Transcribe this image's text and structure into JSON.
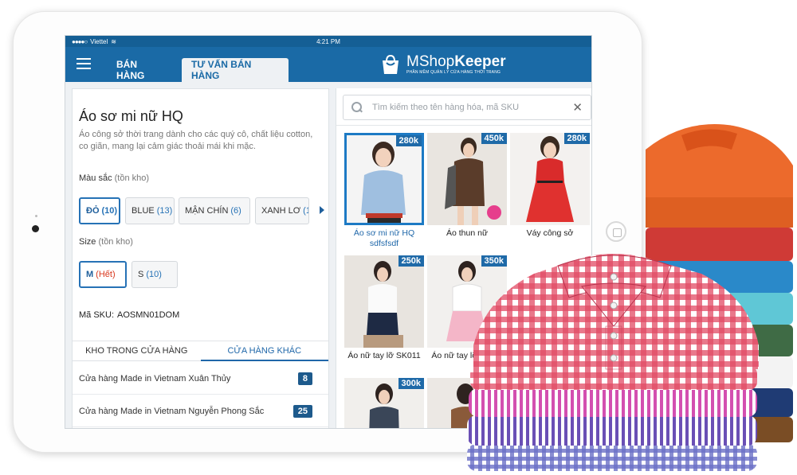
{
  "status_bar": {
    "carrier": "Viettel",
    "time": "4:21 PM"
  },
  "header": {
    "menu_icon": "hamburger-icon",
    "tabs": [
      {
        "label": "BÁN HÀNG",
        "active": false
      },
      {
        "label": "TƯ VẤN BÁN HÀNG",
        "active": true
      }
    ],
    "logo": {
      "name_light": "MShop",
      "name_bold": "Keeper",
      "tagline": "PHẦN MỀM QUẢN LÝ CỬA HÀNG THỜI TRANG"
    }
  },
  "product": {
    "title": "Áo sơ mi nữ HQ",
    "description": "Áo công sở thời trang dành cho các quý cô, chất liệu cotton, co giãn, mang lại cảm giác thoải mái khi mặc.",
    "color_label": "Màu sắc",
    "color_note": "(tồn kho)",
    "colors": [
      {
        "name": "ĐỎ",
        "count": "(10)",
        "selected": true
      },
      {
        "name": "BLUE",
        "count": "(13)",
        "selected": false
      },
      {
        "name": "MẬN CHÍN",
        "count": "(6)",
        "selected": false
      },
      {
        "name": "XANH LƠ",
        "count": "(1",
        "selected": false
      }
    ],
    "size_label": "Size",
    "size_note": "(tồn kho)",
    "sizes": [
      {
        "name": "M",
        "count": "(Hết)",
        "selected": true
      },
      {
        "name": "S",
        "count": "(10)",
        "selected": false
      }
    ],
    "sku_label": "Mã SKU:",
    "sku_value": "AOSMN01DOM"
  },
  "stock_tabs": [
    {
      "label": "KHO TRONG CỬA HÀNG",
      "active": false
    },
    {
      "label": "CỬA HÀNG KHÁC",
      "active": true
    }
  ],
  "stores": [
    {
      "name": "Cửa hàng Made in Vietnam Xuân Thủy",
      "qty": "8"
    },
    {
      "name": "Cửa hàng Made in Vietnam Nguyễn Phong Sắc",
      "qty": "25"
    }
  ],
  "search": {
    "placeholder": "Tìm kiếm theo tên hàng hóa, mã SKU",
    "value": ""
  },
  "products": [
    {
      "price": "280k",
      "name": "Áo sơ mi nữ HQ sdfsfsdf",
      "selected": true
    },
    {
      "price": "450k",
      "name": "Áo thun nữ",
      "selected": false
    },
    {
      "price": "280k",
      "name": "Váy công sở",
      "selected": false
    },
    {
      "price": "250k",
      "name": "Áo nữ tay lỡ SK011",
      "selected": false
    },
    {
      "price": "350k",
      "name": "Áo nữ tay lỡ SW00",
      "selected": false
    },
    {
      "price": "300k",
      "name": "",
      "selected": false
    }
  ],
  "colors": {
    "brand_blue": "#1a6aa6",
    "accent_blue": "#1f6aa8",
    "out_of_stock": "#d9381e"
  }
}
